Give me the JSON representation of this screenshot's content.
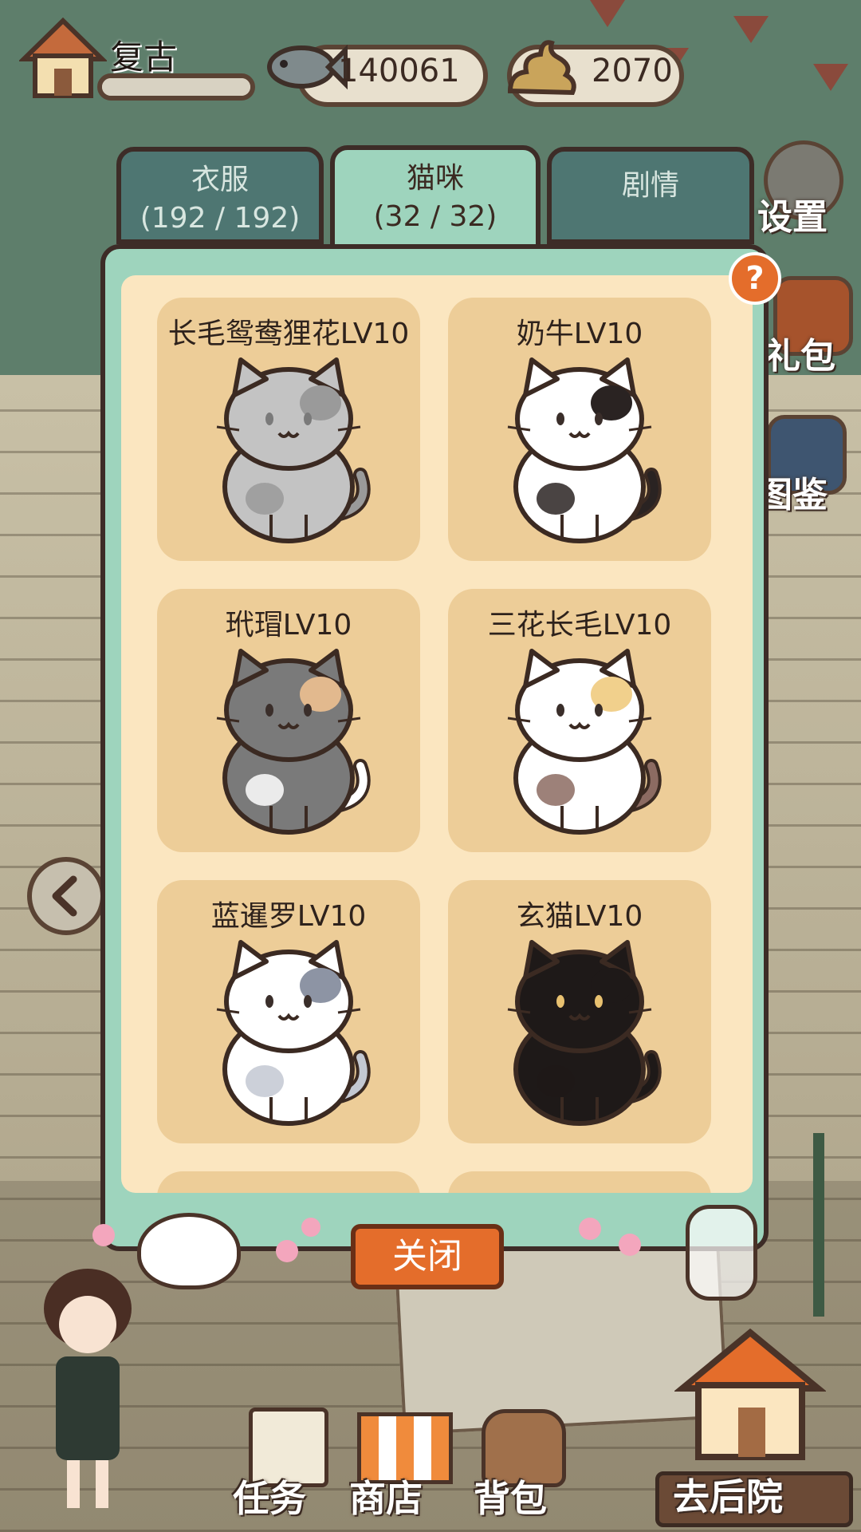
{
  "player": {
    "name": "复古"
  },
  "currency": {
    "fish": "140061",
    "poop": "2070"
  },
  "tabs": [
    {
      "label": "衣服",
      "count": "(192 / 192)"
    },
    {
      "label": "猫咪",
      "count": "(32 / 32)"
    },
    {
      "label": "剧情",
      "count": ""
    }
  ],
  "active_tab": "猫咪",
  "side_menu": {
    "settings": "设置",
    "gift": "礼包",
    "gallery": "图鉴"
  },
  "help_label": "?",
  "cats": [
    {
      "name": "长毛鸳鸯狸花LV10",
      "body": "#c3c3c3",
      "patch1": "#9a9a9a",
      "patch2": "#9a9a9a",
      "eye": "#7a7a7a"
    },
    {
      "name": "奶牛LV10",
      "body": "#ffffff",
      "patch1": "#2a2322",
      "patch2": "#2a2322",
      "eye": "#3a2e2a"
    },
    {
      "name": "玳瑁LV10",
      "body": "#7a7a7a",
      "patch1": "#e2b98e",
      "patch2": "#ffffff",
      "eye": "#3a2e2a"
    },
    {
      "name": "三花长毛LV10",
      "body": "#ffffff",
      "patch1": "#f1d08c",
      "patch2": "#8c6b62",
      "eye": "#3a2e2a"
    },
    {
      "name": "蓝暹罗LV10",
      "body": "#ffffff",
      "patch1": "#8d94a4",
      "patch2": "#c3c8d2",
      "eye": "#3a2e2a"
    },
    {
      "name": "玄猫LV10",
      "body": "#1e1918",
      "patch1": "#1e1918",
      "patch2": "#1e1918",
      "eye": "#e8c170"
    }
  ],
  "close_label": "关闭",
  "bottom_nav": {
    "tasks": "任务",
    "shop": "商店",
    "bag": "背包",
    "backyard": "去后院"
  }
}
